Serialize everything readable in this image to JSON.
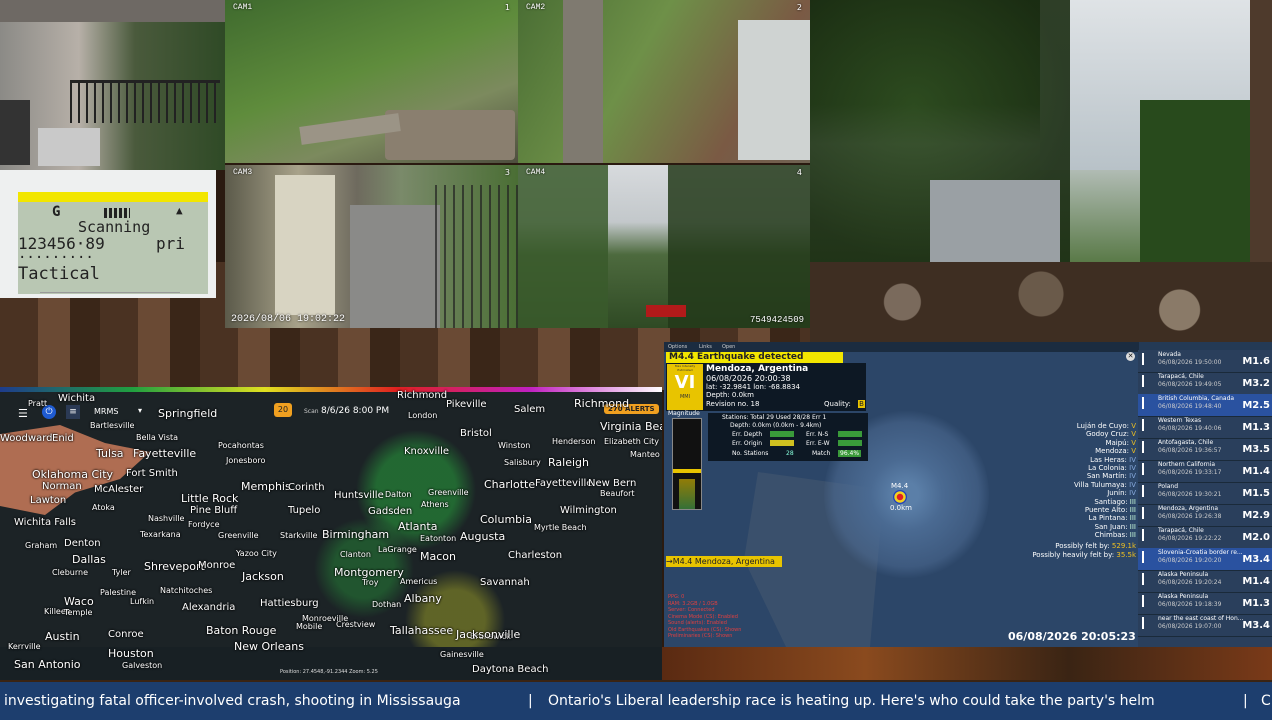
{
  "cameras": [
    {
      "id": "cam1",
      "label": "CAM1",
      "num": "1"
    },
    {
      "id": "cam2",
      "label": "CAM2",
      "num": "2"
    },
    {
      "id": "cam3",
      "label": "CAM3",
      "num": "3",
      "timestamp": "2026/08/06 19:02:22"
    },
    {
      "id": "cam4",
      "label": "CAM4",
      "num": "4",
      "code": "7549424509"
    }
  ],
  "scanner": {
    "line1": "G",
    "status": "Scanning",
    "freq": "123456·89",
    "mode": "pri",
    "dots": "·········",
    "channel": "Tactical"
  },
  "radar": {
    "product": "MRMS",
    "time_label": "Scan",
    "time": "8/6/26 8:00 PM",
    "alerts": "270 ALERTS",
    "position": "Position: 27.4548,-91.2344  Zoom: 5.25",
    "cities": [
      [
        "Wichita",
        58,
        393,
        "c"
      ],
      [
        "Pratt",
        28,
        399,
        "s"
      ],
      [
        "Springfield",
        158,
        407,
        "b"
      ],
      [
        "Pikeville",
        446,
        399,
        "c"
      ],
      [
        "Richmond",
        397,
        390,
        "c"
      ],
      [
        "Richmond",
        574,
        397,
        "b"
      ],
      [
        "Salem",
        514,
        404,
        "c"
      ],
      [
        "Virginia Beach",
        600,
        420,
        "b"
      ],
      [
        "Woodward",
        0,
        433,
        "c"
      ],
      [
        "Enid",
        52,
        433,
        "c"
      ],
      [
        "Bartlesville",
        90,
        421,
        "s"
      ],
      [
        "Bella Vista",
        136,
        433,
        "s"
      ],
      [
        "Pocahontas",
        218,
        441,
        "s"
      ],
      [
        "London",
        408,
        411,
        "s"
      ],
      [
        "Bristol",
        460,
        428,
        "c"
      ],
      [
        "Henderson",
        552,
        437,
        "s"
      ],
      [
        "Elizabeth City",
        604,
        437,
        "s"
      ],
      [
        "Tulsa",
        96,
        447,
        "b"
      ],
      [
        "Fayetteville",
        133,
        447,
        "b"
      ],
      [
        "Jonesboro",
        226,
        456,
        "s"
      ],
      [
        "Knoxville",
        404,
        446,
        "c"
      ],
      [
        "Winston",
        498,
        441,
        "s"
      ],
      [
        "Raleigh",
        548,
        456,
        "b"
      ],
      [
        "Manteo",
        630,
        450,
        "s"
      ],
      [
        "Salisbury",
        504,
        458,
        "s"
      ],
      [
        "Oklahoma City",
        32,
        468,
        "b"
      ],
      [
        "Fort Smith",
        126,
        468,
        "c"
      ],
      [
        "Memphis",
        241,
        480,
        "b"
      ],
      [
        "Corinth",
        288,
        482,
        "c"
      ],
      [
        "Charlotte",
        484,
        478,
        "b"
      ],
      [
        "Fayetteville",
        535,
        478,
        "c"
      ],
      [
        "New Bern",
        588,
        478,
        "c"
      ],
      [
        "Beaufort",
        600,
        489,
        "s"
      ],
      [
        "Norman",
        42,
        481,
        "c"
      ],
      [
        "McAlester",
        94,
        484,
        "c"
      ],
      [
        "Little Rock",
        181,
        492,
        "b"
      ],
      [
        "Huntsville",
        334,
        490,
        "c"
      ],
      [
        "Dalton",
        385,
        490,
        "s"
      ],
      [
        "Greenville",
        428,
        488,
        "s"
      ],
      [
        "Lawton",
        30,
        495,
        "c"
      ],
      [
        "Atoka",
        92,
        503,
        "s"
      ],
      [
        "Pine Bluff",
        190,
        505,
        "c"
      ],
      [
        "Tupelo",
        288,
        505,
        "c"
      ],
      [
        "Gadsden",
        368,
        506,
        "c"
      ],
      [
        "Athens",
        421,
        500,
        "s"
      ],
      [
        "Columbia",
        480,
        513,
        "b"
      ],
      [
        "Wilmington",
        560,
        505,
        "c"
      ],
      [
        "Wichita Falls",
        14,
        517,
        "c"
      ],
      [
        "Nashville",
        148,
        514,
        "s"
      ],
      [
        "Fordyce",
        188,
        520,
        "s"
      ],
      [
        "Greenville",
        218,
        531,
        "s"
      ],
      [
        "Starkville",
        280,
        531,
        "s"
      ],
      [
        "Birmingham",
        322,
        528,
        "b"
      ],
      [
        "Atlanta",
        398,
        520,
        "b"
      ],
      [
        "Augusta",
        460,
        530,
        "b"
      ],
      [
        "Myrtle Beach",
        534,
        523,
        "s"
      ],
      [
        "Graham",
        25,
        541,
        "s"
      ],
      [
        "Denton",
        64,
        538,
        "c"
      ],
      [
        "Texarkana",
        140,
        530,
        "s"
      ],
      [
        "Eatonton",
        420,
        534,
        "s"
      ],
      [
        "Charleston",
        508,
        550,
        "c"
      ],
      [
        "Dallas",
        72,
        553,
        "b"
      ],
      [
        "Shreveport",
        144,
        560,
        "b"
      ],
      [
        "Monroe",
        198,
        560,
        "c"
      ],
      [
        "Yazoo City",
        236,
        549,
        "s"
      ],
      [
        "Jackson",
        242,
        570,
        "b"
      ],
      [
        "Montgomery",
        334,
        566,
        "b"
      ],
      [
        "Clanton",
        340,
        550,
        "s"
      ],
      [
        "LaGrange",
        378,
        545,
        "s"
      ],
      [
        "Macon",
        420,
        550,
        "b"
      ],
      [
        "Savannah",
        480,
        577,
        "c"
      ],
      [
        "Cleburne",
        52,
        568,
        "s"
      ],
      [
        "Tyler",
        112,
        568,
        "s"
      ],
      [
        "Palestine",
        100,
        588,
        "s"
      ],
      [
        "Natchitoches",
        160,
        586,
        "s"
      ],
      [
        "Troy",
        362,
        578,
        "s"
      ],
      [
        "Americus",
        400,
        577,
        "s"
      ],
      [
        "Albany",
        404,
        592,
        "b"
      ],
      [
        "Dothan",
        372,
        600,
        "s"
      ],
      [
        "Waco",
        64,
        595,
        "b"
      ],
      [
        "Lufkin",
        130,
        597,
        "s"
      ],
      [
        "Alexandria",
        182,
        602,
        "c"
      ],
      [
        "Hattiesburg",
        260,
        598,
        "c"
      ],
      [
        "Crestview",
        336,
        620,
        "s"
      ],
      [
        "Brunswick",
        470,
        632,
        "s"
      ],
      [
        "Killeen",
        44,
        607,
        "s"
      ],
      [
        "Temple",
        64,
        608,
        "s"
      ],
      [
        "Baton Rouge",
        206,
        624,
        "b"
      ],
      [
        "Tallahassee",
        390,
        624,
        "b"
      ],
      [
        "Jacksonville",
        456,
        628,
        "b"
      ],
      [
        "Monroeville",
        302,
        614,
        "s"
      ],
      [
        "Austin",
        45,
        630,
        "b"
      ],
      [
        "Conroe",
        108,
        629,
        "c"
      ],
      [
        "Mobile",
        296,
        622,
        "s"
      ],
      [
        "New Orleans",
        234,
        640,
        "b"
      ],
      [
        "Gainesville",
        440,
        650,
        "s"
      ],
      [
        "Kerrville",
        8,
        642,
        "s"
      ],
      [
        "Houston",
        108,
        647,
        "b"
      ],
      [
        "San Antonio",
        14,
        658,
        "b"
      ],
      [
        "Galveston",
        122,
        661,
        "s"
      ],
      [
        "Daytona Beach",
        472,
        664,
        "c"
      ]
    ]
  },
  "quake": {
    "menu": [
      "Options",
      "Links",
      "Open"
    ],
    "headline": "M4.4 Earthquake detected",
    "intensity_tag": "Max Intensity Estimated",
    "intensity": "VI",
    "scale": "MMI",
    "location": "Mendoza, Argentina",
    "datetime": "06/08/2026 20:00:38",
    "latlon": "lat: -32.9841 lon: -68.8834",
    "depth": "Depth: 0.0km",
    "revision": "Revision no. 18",
    "quality_label": "Quality:",
    "quality": "B",
    "magnitude_label": "Magnitude",
    "stations": "Stations: Total 29 Used 28/28 Err 1",
    "depth_detail": "Depth: 0.0km (0.0km - 9.4km)",
    "err_depth": "Err. Depth",
    "err_ns": "Err. N-S",
    "err_origin": "Err. Origin",
    "err_ew": "Err. E-W",
    "no_stations": "No. Stations",
    "no_stations_val": "28",
    "match": "Match",
    "match_val": "96.4%",
    "epicenter_mag": "M4.4",
    "epicenter_depth": "0.0km",
    "banner": "M4.4 Mendoza, Argentina",
    "datetime_footer": "06/08/2026 20:05:23",
    "felt1_label": "Possibly felt by:",
    "felt1_val": "529.1k",
    "felt2_label": "Possibly heavily felt by:",
    "felt2_val": "35.5k",
    "towns": [
      [
        "Luján de Cuyo:",
        "V"
      ],
      [
        "Godoy Cruz:",
        "V"
      ],
      [
        "Maipú:",
        "V"
      ],
      [
        "Mendoza:",
        "V"
      ],
      [
        "Las Heras:",
        "IV"
      ],
      [
        "La Colonia:",
        "IV"
      ],
      [
        "San Martín:",
        "IV"
      ],
      [
        "Villa Tulumaya:",
        "IV"
      ],
      [
        "Junín:",
        "IV"
      ],
      [
        "Santiago:",
        "III"
      ],
      [
        "Puente Alto:",
        "III"
      ],
      [
        "La Pintana:",
        "III"
      ],
      [
        "San Juan:",
        "III"
      ],
      [
        "Chimbas:",
        "III"
      ]
    ],
    "status_lines": [
      "PPG: 0",
      "RAM: 3.2GB / 1.0GB",
      "Server: Connected",
      "Cinema Mode (CS): Enabled",
      "Sound (alerts): Enabled",
      "Old Earthquakes (CS): Shown",
      "Preliminaries (CS): Shown"
    ]
  },
  "quake_list": [
    {
      "region": "Nevada",
      "dt": "06/08/2026 19:50:00",
      "mag": "M1.6"
    },
    {
      "region": "Tarapacá, Chile",
      "dt": "06/08/2026 19:49:05",
      "mag": "M3.2"
    },
    {
      "region": "British Columbia, Canada",
      "dt": "06/08/2026 19:48:40",
      "mag": "M2.5"
    },
    {
      "region": "Western Texas",
      "dt": "06/08/2026 19:40:06",
      "mag": "M1.3"
    },
    {
      "region": "Antofagasta, Chile",
      "dt": "06/08/2026 19:36:57",
      "mag": "M3.5"
    },
    {
      "region": "Northern California",
      "dt": "06/08/2026 19:33:17",
      "mag": "M1.4"
    },
    {
      "region": "Poland",
      "dt": "06/08/2026 19:30:21",
      "mag": "M1.5"
    },
    {
      "region": "Mendoza, Argentina",
      "dt": "06/08/2026 19:26:38",
      "mag": "M2.9"
    },
    {
      "region": "Tarapacá, Chile",
      "dt": "06/08/2026 19:22:22",
      "mag": "M2.0"
    },
    {
      "region": "Slovenia-Croatia border re...",
      "dt": "06/08/2026 19:20:20",
      "mag": "M3.4"
    },
    {
      "region": "Alaska Peninsula",
      "dt": "06/08/2026 19:20:24",
      "mag": "M1.4"
    },
    {
      "region": "Alaska Peninsula",
      "dt": "06/08/2026 19:18:39",
      "mag": "M1.3"
    },
    {
      "region": "near the east coast of Hon...",
      "dt": "06/08/2026 19:07:00",
      "mag": "M3.4"
    }
  ],
  "ticker": {
    "items": [
      "investigating fatal officer-involved crash, shooting in Mississauga",
      "Ontario's Liberal leadership race is heating up. Here's who could take the party's helm",
      "C"
    ],
    "separator": "|"
  },
  "colors": {
    "ticker_bg": "#1d3e6e",
    "alert_yellow": "#f2e600",
    "quake_bg": "#243a55",
    "radar_bg": "#1c2326",
    "storm_fill": "#c97a5a"
  }
}
